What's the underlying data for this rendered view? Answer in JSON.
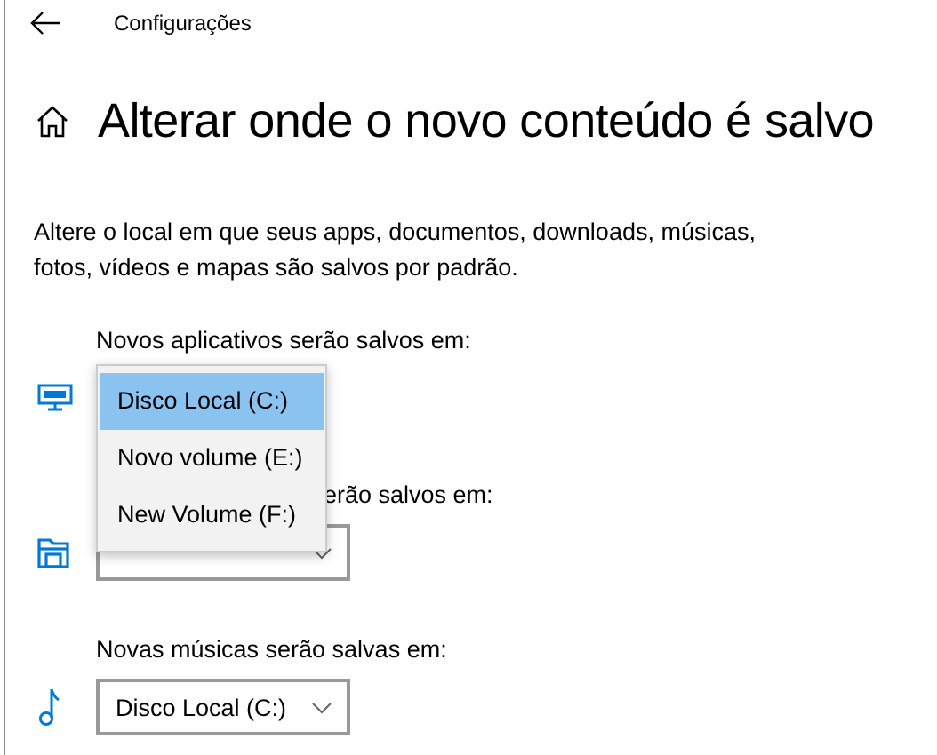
{
  "header": {
    "title": "Configurações"
  },
  "page": {
    "title": "Alterar onde o novo conteúdo é salvo",
    "description": "Altere o local em que seus apps, documentos, downloads, músicas, fotos, vídeos e mapas são salvos por padrão."
  },
  "sections": [
    {
      "kind": "apps",
      "label": "Novos aplicativos serão salvos em:",
      "dropdown": {
        "expanded": true,
        "options": [
          {
            "label": "Disco Local (C:)",
            "selected": true
          },
          {
            "label": "Novo volume (E:)",
            "selected": false
          },
          {
            "label": "New Volume (F:)",
            "selected": false
          }
        ]
      }
    },
    {
      "kind": "documents",
      "label": "erão salvos em:",
      "partially_covered": true,
      "dropdown": {
        "expanded": false
      }
    },
    {
      "kind": "music",
      "label": "Novas músicas serão salvas em:",
      "dropdown": {
        "expanded": false,
        "value": "Disco Local (C:)"
      }
    }
  ]
}
